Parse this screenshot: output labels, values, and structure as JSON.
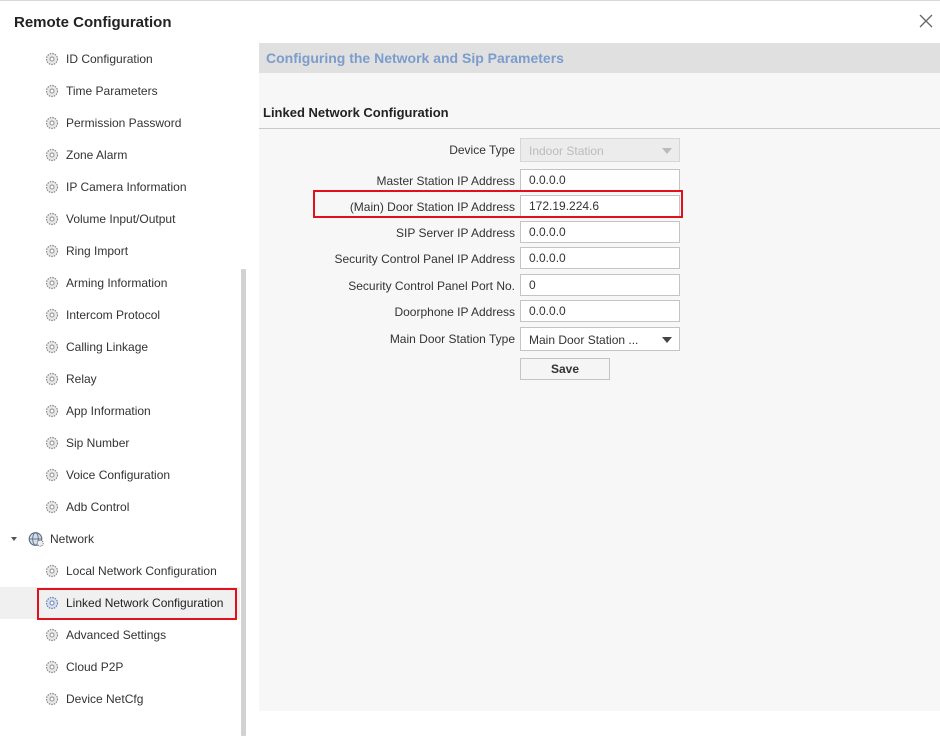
{
  "window": {
    "title": "Remote Configuration"
  },
  "sidebar": {
    "items": [
      {
        "label": "ID Configuration"
      },
      {
        "label": "Time Parameters"
      },
      {
        "label": "Permission Password"
      },
      {
        "label": "Zone Alarm"
      },
      {
        "label": "IP Camera Information"
      },
      {
        "label": "Volume Input/Output"
      },
      {
        "label": "Ring Import"
      },
      {
        "label": "Arming Information"
      },
      {
        "label": "Intercom Protocol"
      },
      {
        "label": "Calling Linkage"
      },
      {
        "label": "Relay"
      },
      {
        "label": "App Information"
      },
      {
        "label": "Sip Number"
      },
      {
        "label": "Voice Configuration"
      },
      {
        "label": "Adb Control"
      }
    ],
    "group": {
      "label": "Network",
      "expanded": true
    },
    "network_items": [
      {
        "label": "Local Network Configuration"
      },
      {
        "label": "Linked Network Configuration",
        "selected": true
      },
      {
        "label": "Advanced Settings"
      },
      {
        "label": "Cloud P2P"
      },
      {
        "label": "Device NetCfg"
      }
    ]
  },
  "main": {
    "header_title": "Configuring the Network and Sip Parameters",
    "section_title": "Linked Network Configuration",
    "fields": {
      "device_type": {
        "label": "Device Type",
        "value": "Indoor Station"
      },
      "master_ip": {
        "label": "Master Station IP Address",
        "value": "0.0.0.0"
      },
      "door_ip": {
        "label": "(Main) Door Station IP Address",
        "value": "172.19.224.6"
      },
      "sip_ip": {
        "label": "SIP Server IP Address",
        "value": "0.0.0.0"
      },
      "security_ip": {
        "label": "Security Control Panel IP Address",
        "value": "0.0.0.0"
      },
      "security_port": {
        "label": "Security Control Panel Port No.",
        "value": "0"
      },
      "doorphone_ip": {
        "label": "Doorphone IP Address",
        "value": "0.0.0.0"
      },
      "door_type": {
        "label": "Main Door Station Type",
        "value": "Main Door Station ..."
      }
    },
    "save_label": "Save"
  },
  "colors": {
    "accent_title": "#7b9ccc",
    "highlight": "#e0101c",
    "header_bg": "#e0e0e0",
    "panel_bg": "#f7f7f7"
  },
  "icons": {
    "tree_item": "gear-icon",
    "tree_group": "globe-icon",
    "expand": "triangle-down-icon",
    "close": "close-icon",
    "select_arrow": "chevron-down-icon"
  }
}
